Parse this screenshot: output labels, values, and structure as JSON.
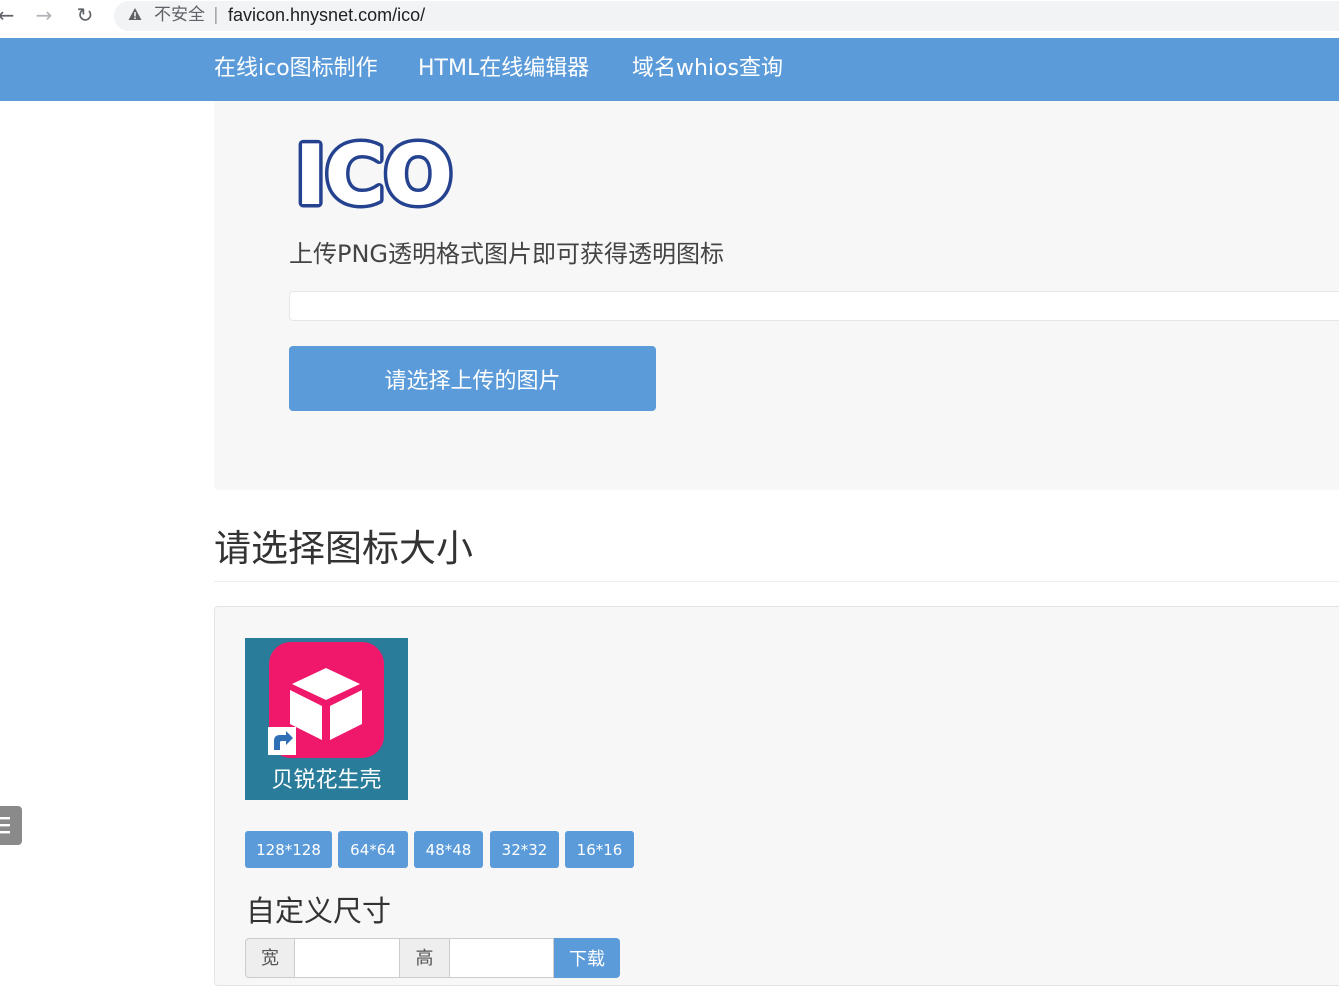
{
  "browser": {
    "security_label": "不安全",
    "separator": "|",
    "url": "favicon.hnysnet.com/ico/"
  },
  "navbar": {
    "links": [
      "在线ico图标制作",
      "HTML在线编辑器",
      "域名whios查询"
    ]
  },
  "upload": {
    "logo_text": "ICO",
    "tip": "上传PNG透明格式图片即可获得透明图标",
    "progress": 0,
    "button_label": "请选择上传的图片"
  },
  "sizes": {
    "title": "请选择图标大小",
    "preview_caption": "贝锐花生壳",
    "buttons": [
      "128*128",
      "64*64",
      "48*48",
      "32*32",
      "16*16"
    ]
  },
  "custom": {
    "title": "自定义尺寸",
    "width_label": "宽",
    "height_label": "高",
    "width_value": "",
    "height_value": "",
    "download_label": "下载"
  },
  "colors": {
    "accent": "#5b9bd9",
    "preview_bg": "#2a7d9a",
    "app_icon_pink": "#f0186b"
  }
}
